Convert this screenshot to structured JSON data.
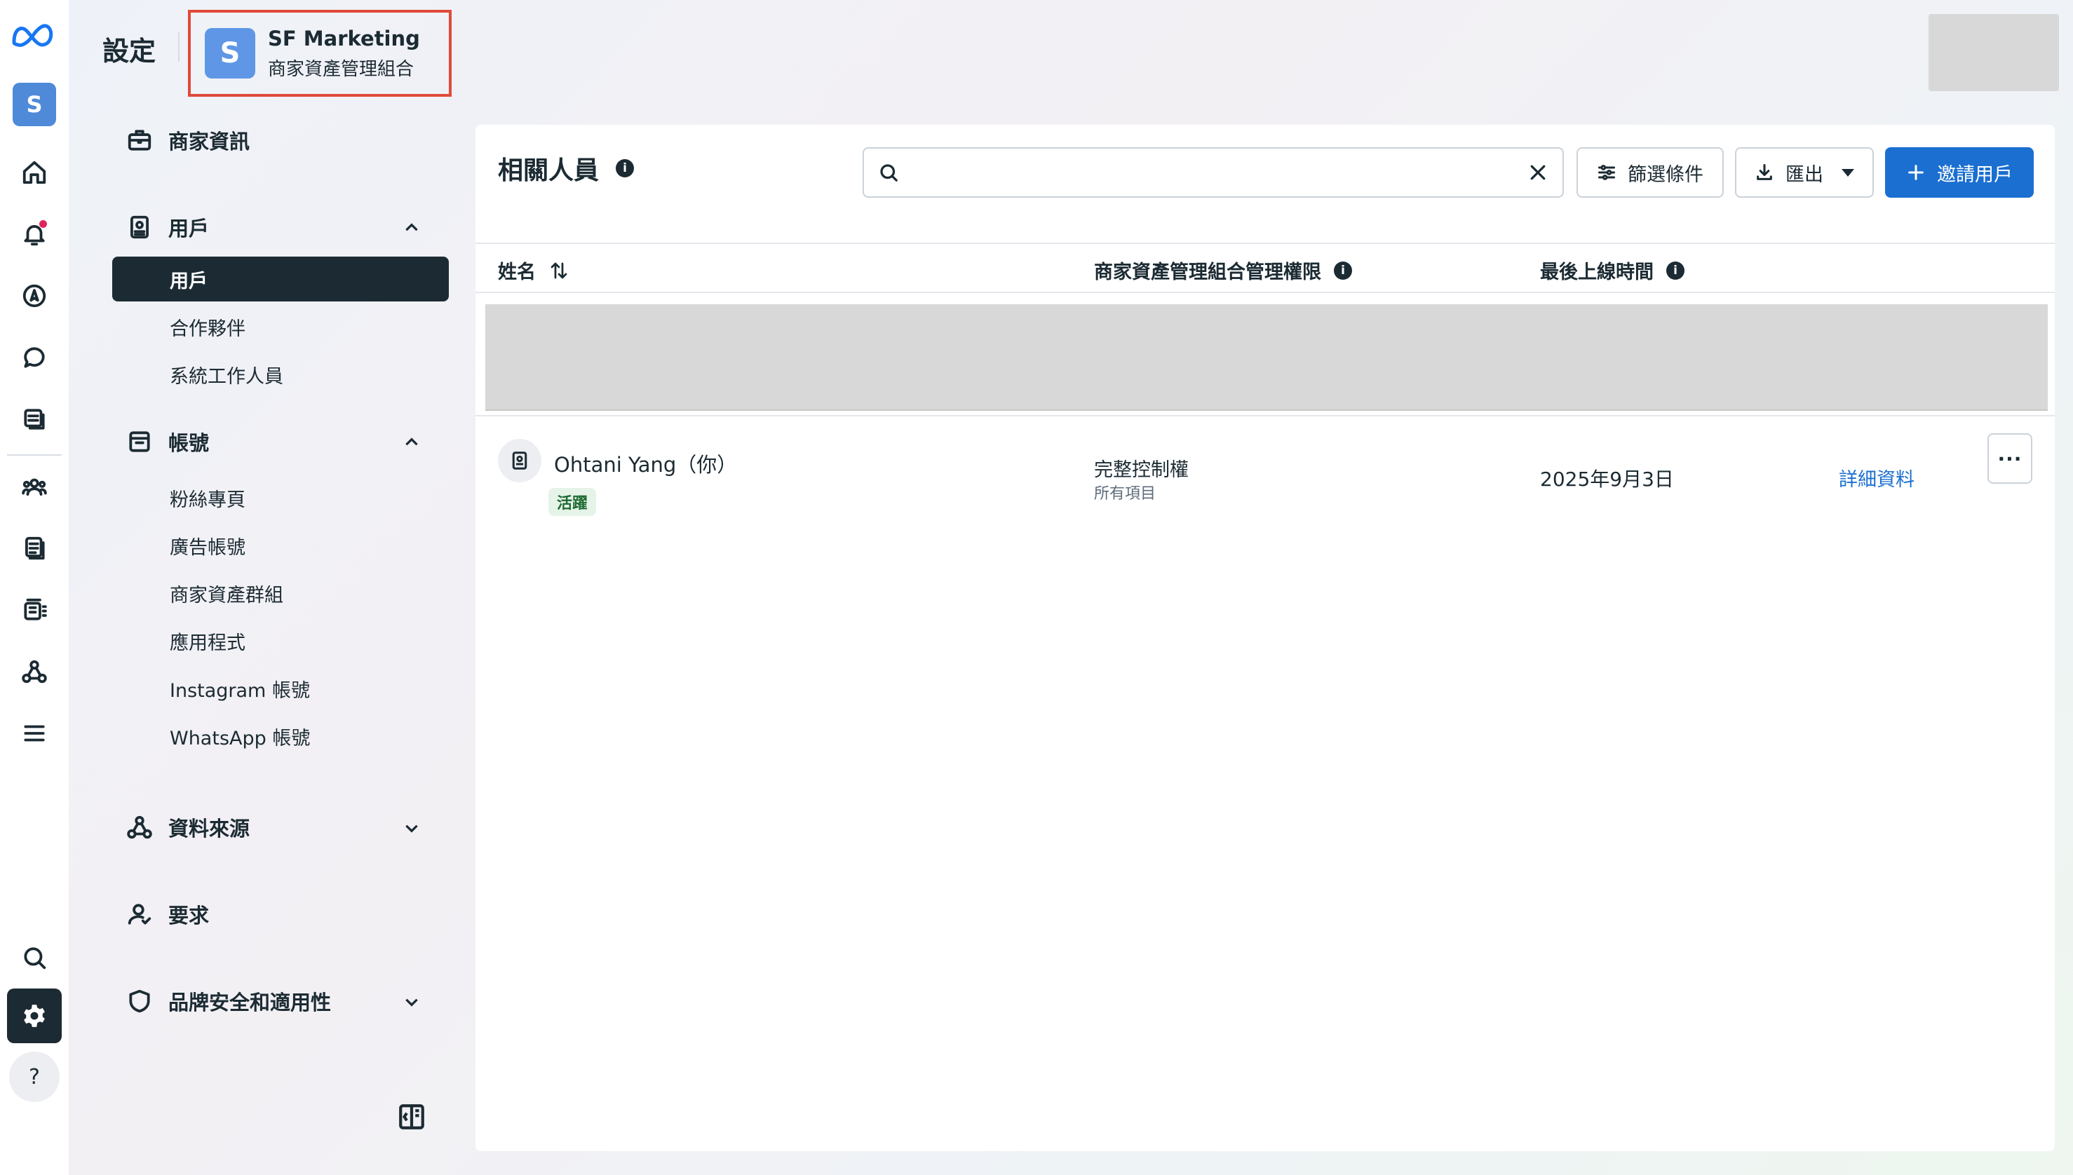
{
  "header": {
    "title": "設定",
    "business_initial": "S",
    "business_name": "SF Marketing",
    "business_type": "商家資產管理組合"
  },
  "rail": {
    "icons": [
      "meta-logo",
      "home-icon",
      "bell-icon",
      "compass-icon",
      "chat-icon",
      "pages-icon",
      "people-icon",
      "document-icon",
      "catalog-icon",
      "graph-icon",
      "menu-icon",
      "search-icon",
      "settings-icon",
      "help-icon"
    ],
    "help_label": "?"
  },
  "sidebar": {
    "business_info": "商家資訊",
    "users": {
      "label": "用戶",
      "items": [
        "用戶",
        "合作夥伴",
        "系統工作人員"
      ],
      "active": "用戶"
    },
    "accounts": {
      "label": "帳號",
      "items": [
        "粉絲專頁",
        "廣告帳號",
        "商家資產群組",
        "應用程式",
        "Instagram 帳號",
        "WhatsApp 帳號"
      ]
    },
    "data_sources": "資料來源",
    "requests": "要求",
    "brand_safety": "品牌安全和適用性"
  },
  "main": {
    "title": "相關人員",
    "search": {
      "value": "",
      "placeholder": ""
    },
    "filter_label": "篩選條件",
    "export_label": "匯出",
    "invite_label": "邀請用戶",
    "columns": {
      "name": "姓名",
      "permission": "商家資產管理組合管理權限",
      "last_active": "最後上線時間"
    },
    "rows": [
      {
        "name": "Ohtani Yang（你）",
        "status": "活躍",
        "permission": "完整控制權",
        "permission_scope": "所有項目",
        "last_active": "2025年9月3日",
        "details_label": "詳細資料",
        "more_label": "···"
      }
    ]
  },
  "colors": {
    "accent": "#1a6fd1",
    "active_nav": "#1c2b33",
    "highlight_border": "#e04a3a",
    "status_active_bg": "#e6f3e8"
  }
}
